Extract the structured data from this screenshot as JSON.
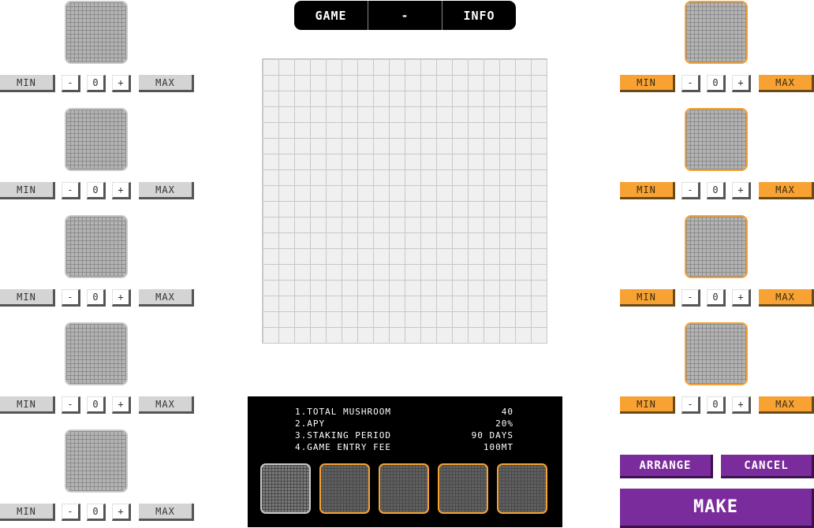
{
  "nav": {
    "left": "GAME",
    "middle": "-",
    "right": "INFO"
  },
  "controls": {
    "min_label": "MIN",
    "max_label": "MAX",
    "minus_label": "-",
    "plus_label": "+"
  },
  "left_slots": [
    {
      "value": "0"
    },
    {
      "value": "0"
    },
    {
      "value": "0"
    },
    {
      "value": "0"
    },
    {
      "value": "0"
    }
  ],
  "right_slots": [
    {
      "value": "0"
    },
    {
      "value": "0"
    },
    {
      "value": "0"
    },
    {
      "value": "0"
    }
  ],
  "info": {
    "rows": [
      {
        "label": "1.TOTAL MUSHROOM",
        "value": "40"
      },
      {
        "label": "2.APY",
        "value": "20%"
      },
      {
        "label": "3.STAKING PERIOD",
        "value": "90 DAYS"
      },
      {
        "label": "4.GAME ENTRY FEE",
        "value": "100MT"
      }
    ]
  },
  "actions": {
    "arrange": "ARRANGE",
    "cancel": "CANCEL",
    "make": "MAKE"
  },
  "colors": {
    "accent_orange": "#f7a233",
    "accent_purple": "#7b2c9c",
    "panel_black": "#000000"
  }
}
